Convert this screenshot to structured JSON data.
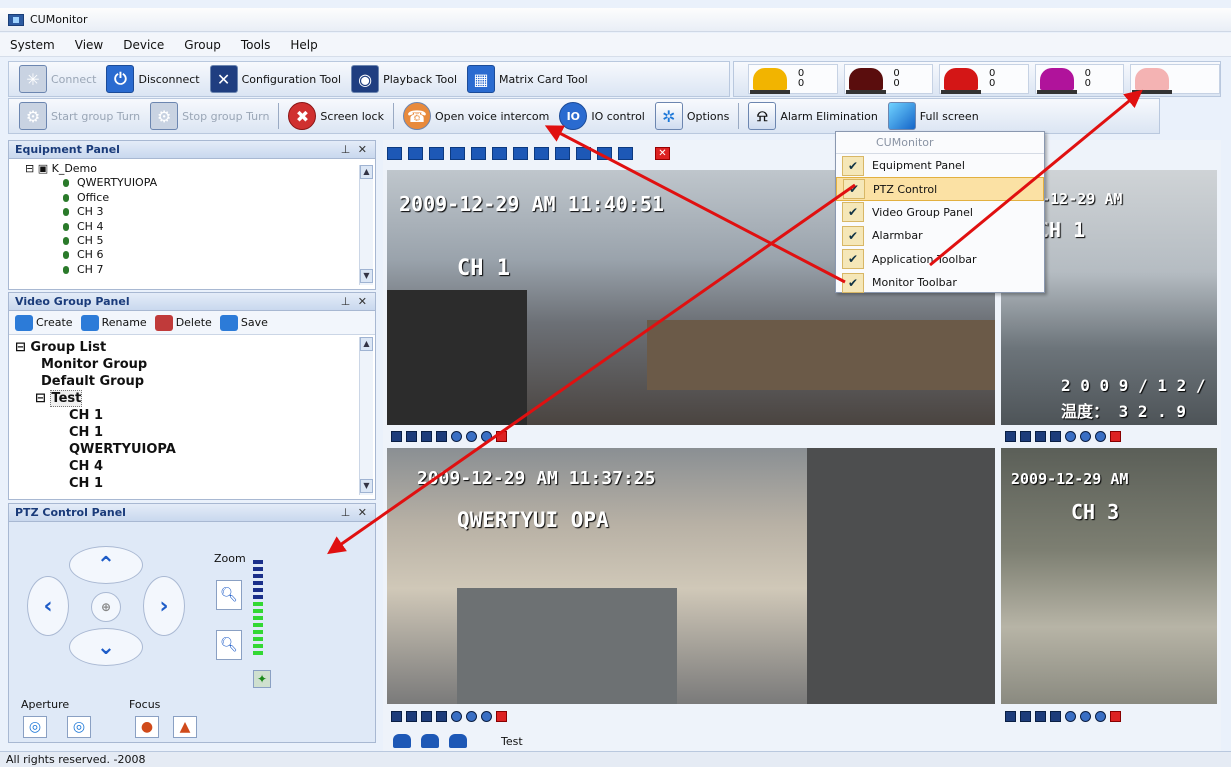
{
  "window": {
    "title": "CUMonitor"
  },
  "menu": [
    "System",
    "View",
    "Device",
    "Group",
    "Tools",
    "Help"
  ],
  "app_toolbar": [
    {
      "label": "Connect",
      "icon": "connect-icon",
      "enabled": false
    },
    {
      "label": "Disconnect",
      "icon": "power-icon",
      "enabled": true
    },
    {
      "label": "Configuration Tool",
      "icon": "tools-icon",
      "enabled": true
    },
    {
      "label": "Playback Tool",
      "icon": "playback-icon",
      "enabled": true
    },
    {
      "label": "Matrix Card Tool",
      "icon": "grid-icon",
      "enabled": true
    }
  ],
  "monitor_toolbar": [
    {
      "label": "Start group Turn",
      "icon": "gear-icon",
      "enabled": false
    },
    {
      "label": "Stop group Turn",
      "icon": "gear-icon",
      "enabled": false
    },
    {
      "label": "Screen lock",
      "icon": "lock-icon",
      "enabled": true
    },
    {
      "label": "Open voice intercom",
      "icon": "intercom-icon",
      "enabled": true
    },
    {
      "label": "IO control",
      "icon": "io-icon",
      "enabled": true
    },
    {
      "label": "Options",
      "icon": "options-icon",
      "enabled": true
    },
    {
      "label": "Alarm Elimination",
      "icon": "siren-icon",
      "enabled": true
    },
    {
      "label": "Full screen",
      "icon": "fullscreen-icon",
      "enabled": true
    }
  ],
  "alarmbar": [
    {
      "color": "#f2b400",
      "top": "0",
      "bottom": "0"
    },
    {
      "color": "#5a0d0d",
      "top": "0",
      "bottom": "0"
    },
    {
      "color": "#d41616",
      "top": "0",
      "bottom": "0"
    },
    {
      "color": "#b0139b",
      "top": "0",
      "bottom": "0"
    },
    {
      "color": "#f4b3b3",
      "top": "",
      "bottom": ""
    }
  ],
  "equipment_panel": {
    "title": "Equipment Panel",
    "device": "K_Demo",
    "channels": [
      "QWERTYUIOPA",
      "Office",
      "CH 3",
      "CH 4",
      "CH 5",
      "CH 6",
      "CH 7"
    ]
  },
  "video_group_panel": {
    "title": "Video Group Panel",
    "buttons": [
      "Create",
      "Rename",
      "Delete",
      "Save"
    ],
    "root": "Group List",
    "groups": [
      "Monitor Group",
      "Default Group"
    ],
    "expanded_group": "Test",
    "test_items": [
      "CH 1",
      "CH 1",
      "QWERTYUIOPA",
      "CH 4",
      "CH 1"
    ]
  },
  "ptz_panel": {
    "title": "PTZ Control Panel",
    "zoom_label": "Zoom",
    "aperture_label": "Aperture",
    "focus_label": "Focus"
  },
  "videos": [
    {
      "timestamp": "2009-12-29 AM 11:40:51",
      "name": "CH 1"
    },
    {
      "timestamp": "2009-12-29 AM",
      "name": "CH 1",
      "extra1": "2 0 0 9 / 1 2 /",
      "extra2": "温度：  3 2 . 9"
    },
    {
      "timestamp": "2009-12-29 AM 11:37:25",
      "name": "QWERTYUI OPA"
    },
    {
      "timestamp": "2009-12-29 AM",
      "name": "CH 3"
    }
  ],
  "bottom_tab_label": "Test",
  "context_menu": {
    "header": "CUMonitor",
    "items": [
      {
        "label": "Equipment Panel",
        "checked": true
      },
      {
        "label": "PTZ Control",
        "checked": true
      },
      {
        "label": "Video Group Panel",
        "checked": true
      },
      {
        "label": "Alarmbar",
        "checked": true
      },
      {
        "label": "Application Toolbar",
        "checked": true
      },
      {
        "label": "Monitor Toolbar",
        "checked": true
      }
    ]
  },
  "status": "All rights reserved. -2008"
}
